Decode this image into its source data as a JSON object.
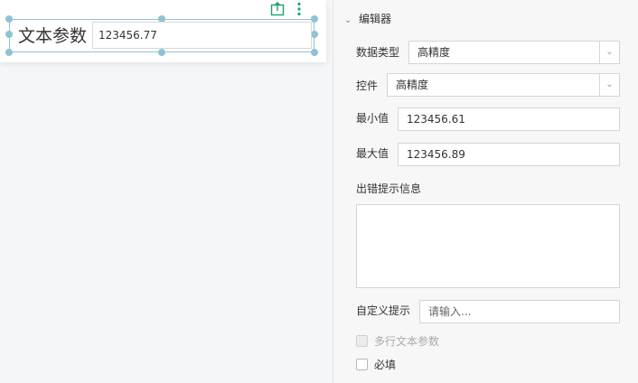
{
  "widget": {
    "label": "文本参数",
    "value": "123456.77",
    "toolbar": {
      "export_icon": "export-icon",
      "more_icon": "more-vertical-icon",
      "accent": "#1aa36b"
    }
  },
  "panel": {
    "section_title": "编辑器",
    "data_type": {
      "label": "数据类型",
      "value": "高精度"
    },
    "control": {
      "label": "控件",
      "value": "高精度"
    },
    "min": {
      "label": "最小值",
      "value": "123456.61"
    },
    "max": {
      "label": "最大值",
      "value": "123456.89"
    },
    "error_msg": {
      "label": "出错提示信息",
      "value": ""
    },
    "custom_hint": {
      "label": "自定义提示",
      "placeholder": "请输入..."
    },
    "multiline": {
      "label": "多行文本参数",
      "checked": false,
      "disabled": true
    },
    "required": {
      "label": "必填",
      "checked": false
    }
  }
}
